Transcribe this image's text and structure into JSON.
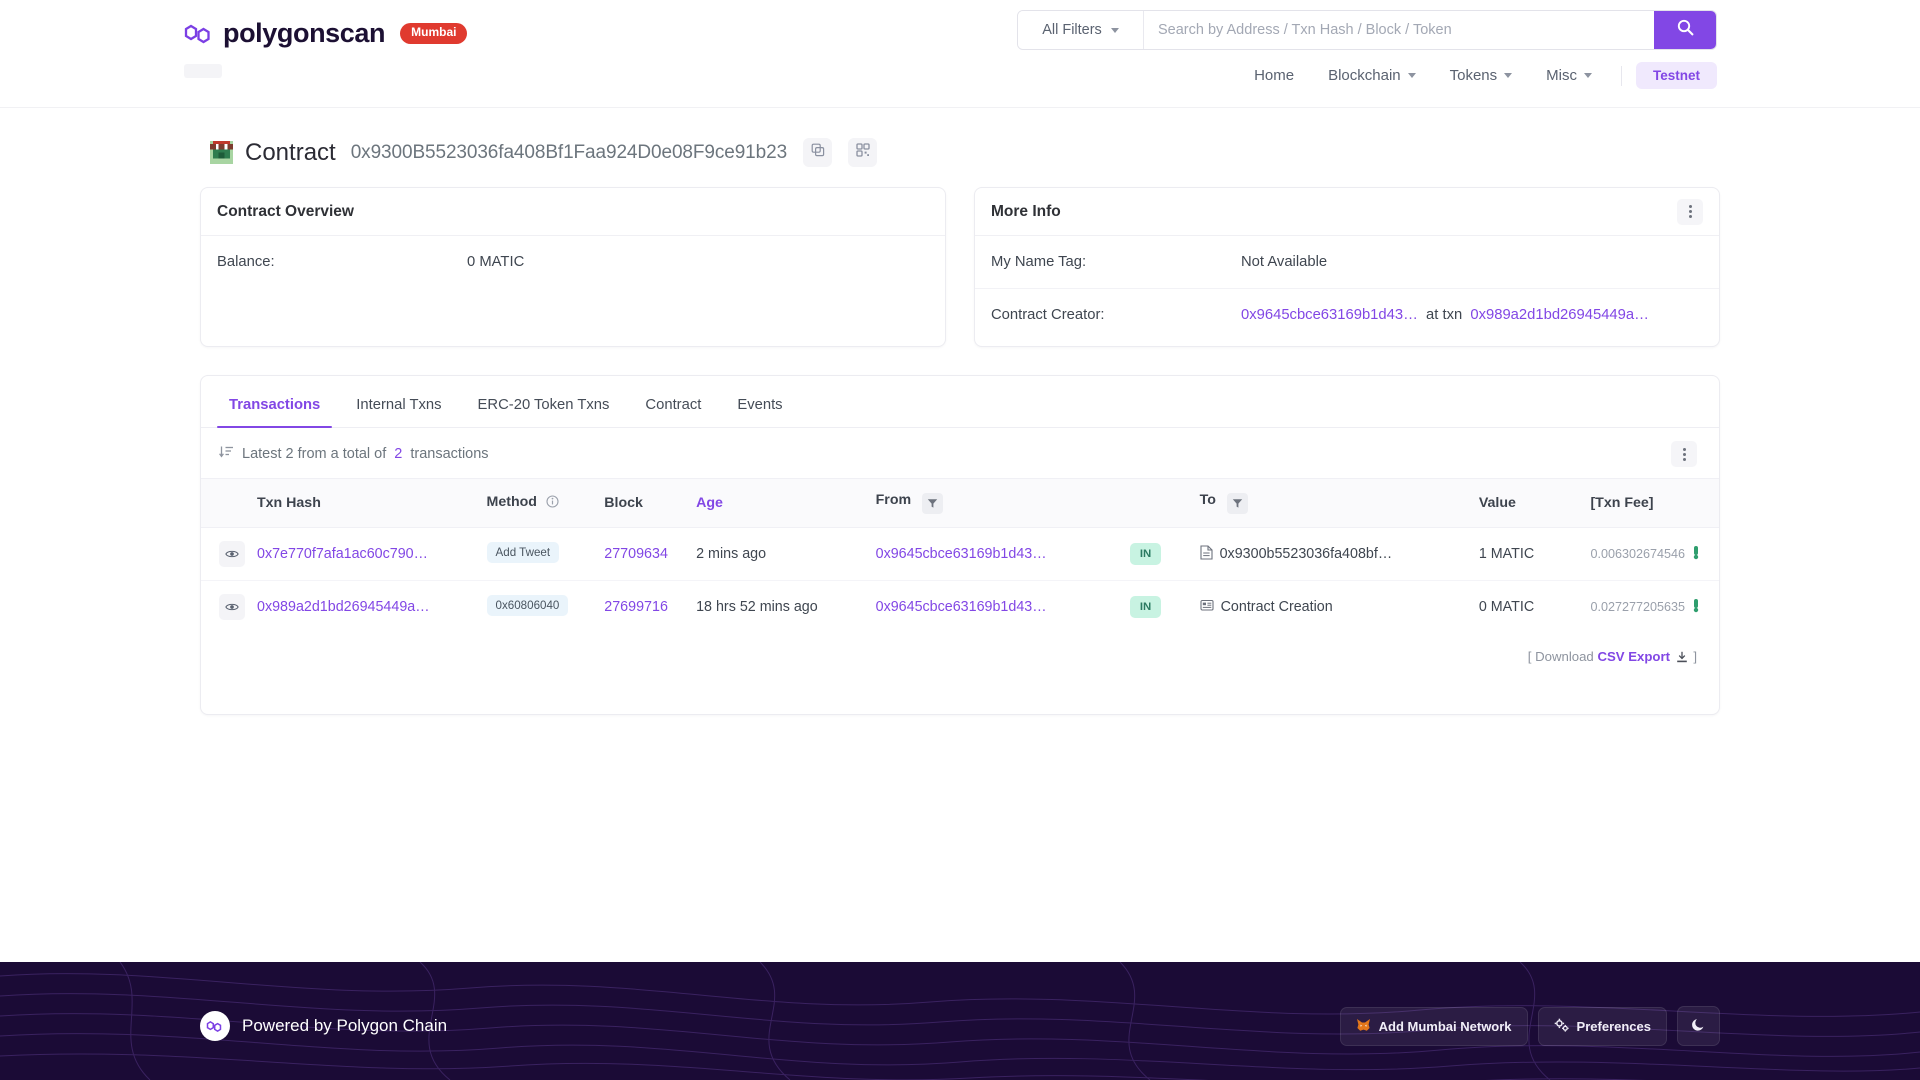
{
  "header": {
    "brand": "polygonscan",
    "network_badge": "Mumbai",
    "search": {
      "filters_label": "All Filters",
      "placeholder": "Search by Address / Txn Hash / Block / Token",
      "value": "",
      "submit_icon": "search-icon"
    },
    "nav": [
      {
        "label": "Home",
        "has_caret": false
      },
      {
        "label": "Blockchain",
        "has_caret": true
      },
      {
        "label": "Tokens",
        "has_caret": true
      },
      {
        "label": "Misc",
        "has_caret": true
      }
    ],
    "testnet_badge": "Testnet"
  },
  "page_title": {
    "label": "Contract",
    "address": "0x9300B5523036fa408Bf1Faa924D0e08F9ce91b23",
    "copy_icon": "copy-icon",
    "qr_icon": "qr-code-icon"
  },
  "overview_card": {
    "title": "Contract Overview",
    "rows": [
      {
        "key": "Balance:",
        "value": "0 MATIC"
      }
    ]
  },
  "more_info_card": {
    "title": "More Info",
    "menu_icon": "kebab-menu-icon",
    "rows": [
      {
        "key": "My Name Tag:",
        "value": "Not Available"
      }
    ],
    "creator": {
      "key": "Contract Creator:",
      "address": "0x9645cbce63169b1d43…",
      "connector": "at txn",
      "txn": "0x989a2d1bd26945449a…"
    }
  },
  "tx_panel": {
    "tabs": [
      {
        "label": "Transactions",
        "active": true
      },
      {
        "label": "Internal Txns",
        "active": false
      },
      {
        "label": "ERC-20 Token Txns",
        "active": false
      },
      {
        "label": "Contract",
        "active": false
      },
      {
        "label": "Events",
        "active": false
      }
    ],
    "summary_prefix": "Latest 2 from a total of",
    "summary_count": "2",
    "summary_suffix": "transactions",
    "sort_icon": "sort-descending-icon",
    "menu_icon": "kebab-menu-icon",
    "columns": [
      "",
      "Txn Hash",
      "Method",
      "Block",
      "Age",
      "From",
      "",
      "To",
      "Value",
      "[Txn Fee]"
    ],
    "method_info_icon": "info-icon",
    "from_filter_icon": "filter-icon",
    "to_filter_icon": "filter-icon",
    "rows": [
      {
        "eye_icon": "eye-icon",
        "hash": "0x7e770f7afa1ac60c790…",
        "method": "Add Tweet",
        "block": "27709634",
        "age": "2 mins ago",
        "from": "0x9645cbce63169b1d43…",
        "direction": "IN",
        "to_icon": "contract-document-icon",
        "to": "0x9300b5523036fa408bf…",
        "to_is_link": true,
        "value": "1 MATIC",
        "fee": "0.006302674546"
      },
      {
        "eye_icon": "eye-icon",
        "hash": "0x989a2d1bd26945449a…",
        "method": "0x60806040",
        "block": "27699716",
        "age": "18 hrs 52 mins ago",
        "from": "0x9645cbce63169b1d43…",
        "direction": "IN",
        "to_icon": "contract-creation-icon",
        "to": "Contract Creation",
        "to_is_link": false,
        "value": "0 MATIC",
        "fee": "0.027277205635"
      }
    ],
    "csv": {
      "open_bracket": "[ Download",
      "link": "CSV Export",
      "close_bracket": "]",
      "icon": "download-icon"
    }
  },
  "footer": {
    "powered_by": "Powered by Polygon Chain",
    "buttons": [
      {
        "label": "Add Mumbai Network",
        "icon": "metamask-fox-icon"
      },
      {
        "label": "Preferences",
        "icon": "gears-icon"
      }
    ],
    "theme_toggle_icon": "moon-icon"
  },
  "colors": {
    "accent": "#8247e5",
    "network_badge": "#e03a2f",
    "in_badge_bg": "#c8f3e2",
    "in_badge_text": "#2b7a62",
    "method_badge_bg": "#eaf4fb",
    "footer_bg": "#1b0b36"
  }
}
